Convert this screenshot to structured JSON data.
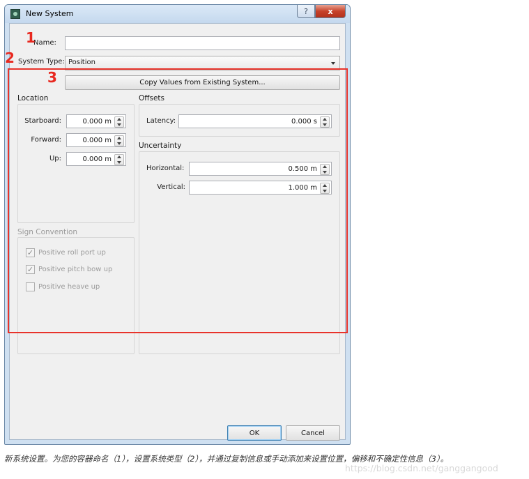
{
  "window": {
    "title": "New System",
    "help_label": "?",
    "close_label": "x"
  },
  "form": {
    "name_label": "Name:",
    "name_value": "",
    "system_type_label": "System Type:",
    "system_type_value": "Position",
    "copy_button": "Copy Values from Existing System..."
  },
  "location": {
    "header": "Location",
    "fields": [
      {
        "label": "Starboard:",
        "value": "0.000 m"
      },
      {
        "label": "Forward:",
        "value": "0.000 m"
      },
      {
        "label": "Up:",
        "value": "0.000 m"
      }
    ]
  },
  "offsets": {
    "header": "Offsets",
    "latency_label": "Latency:",
    "latency_value": "0.000 s"
  },
  "uncertainty": {
    "header": "Uncertainty",
    "horizontal_label": "Horizontal:",
    "horizontal_value": "0.500 m",
    "vertical_label": "Vertical:",
    "vertical_value": "1.000 m"
  },
  "sign_convention": {
    "header": "Sign Convention",
    "items": [
      {
        "label": "Positive roll port up",
        "checked": true
      },
      {
        "label": "Positive pitch bow up",
        "checked": true
      },
      {
        "label": "Positive heave up",
        "checked": false
      }
    ]
  },
  "buttons": {
    "ok": "OK",
    "cancel": "Cancel"
  },
  "annotations": {
    "n1": "1",
    "n2": "2",
    "n3": "3",
    "color": "#e8332b"
  },
  "caption": "新系统设置。为您的容器命名（1），设置系统类型（2），并通过复制信息或手动添加来设置位置，偏移和不确定性信息（3）。",
  "watermark": "https://blog.csdn.net/ganggangood"
}
